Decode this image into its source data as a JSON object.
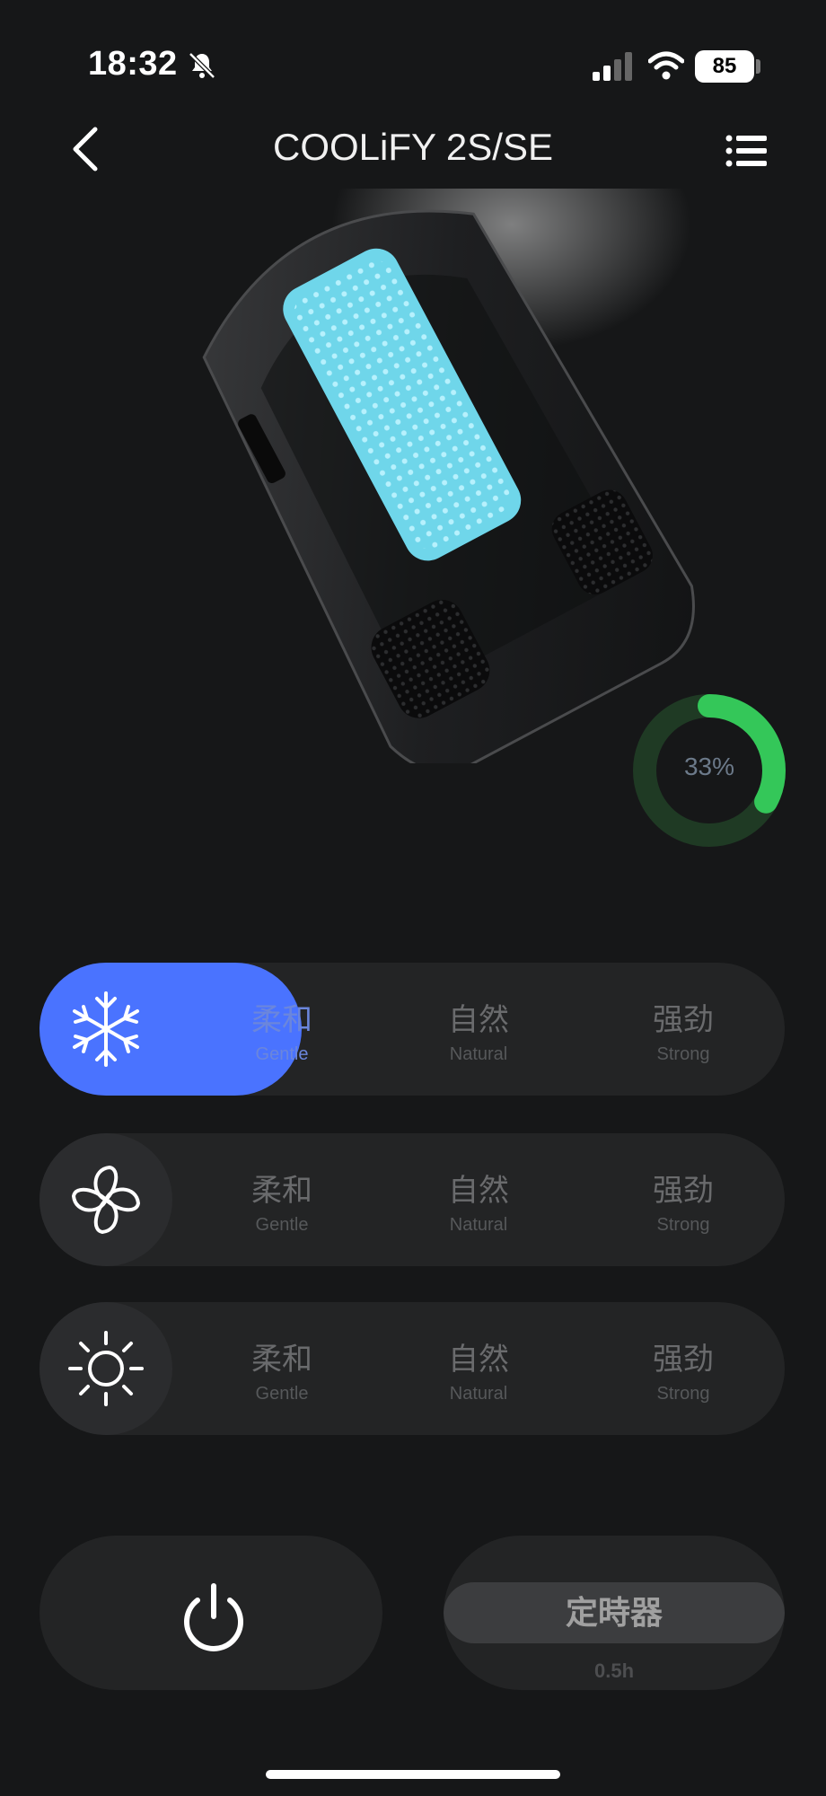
{
  "status_bar": {
    "time": "18:32",
    "battery": "85",
    "icons": [
      "bell-slash-icon",
      "cellular-signal-icon",
      "wifi-icon",
      "battery-icon"
    ]
  },
  "nav": {
    "title": "COOLiFY 2S/SE",
    "back_icon": "chevron-left-icon",
    "menu_icon": "list-menu-icon"
  },
  "battery_ring": {
    "label": "33%",
    "level": 0.33,
    "color": "#34c759",
    "track_color": "#1f3a24"
  },
  "modes": [
    {
      "icon": "snowflake-icon",
      "active": true,
      "options": [
        {
          "zh": "柔和",
          "en": "Gentle"
        },
        {
          "zh": "自然",
          "en": "Natural"
        },
        {
          "zh": "强劲",
          "en": "Strong"
        }
      ]
    },
    {
      "icon": "fan-icon",
      "active": false,
      "options": [
        {
          "zh": "柔和",
          "en": "Gentle"
        },
        {
          "zh": "自然",
          "en": "Natural"
        },
        {
          "zh": "强劲",
          "en": "Strong"
        }
      ]
    },
    {
      "icon": "sun-icon",
      "active": false,
      "options": [
        {
          "zh": "柔和",
          "en": "Gentle"
        },
        {
          "zh": "自然",
          "en": "Natural"
        },
        {
          "zh": "强劲",
          "en": "Strong"
        }
      ]
    }
  ],
  "power": {
    "icon": "power-icon"
  },
  "timer": {
    "label": "定時器",
    "value": "0.5h"
  },
  "colors": {
    "accent": "#4a73ff",
    "background": "#161718",
    "row": "#232425"
  }
}
